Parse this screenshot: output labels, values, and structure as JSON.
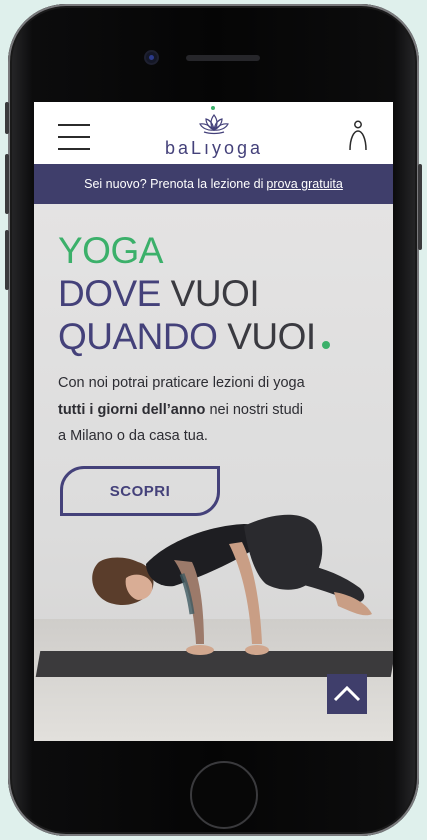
{
  "header": {
    "brand": "baLıyoga",
    "menu_icon": "hamburger-menu-icon",
    "user_icon": "user-icon"
  },
  "banner": {
    "text": "Sei nuovo? Prenota la lezione di",
    "link": "prova gratuita"
  },
  "hero": {
    "line1": "YOGA",
    "line2_a": "DOVE",
    "line2_b": "VUOI",
    "line3_a": "QUANDO",
    "line3_b": "VUOI",
    "desc_1": "Con noi potrai praticare lezioni di yoga",
    "desc_bold": "tutti i giorni dell’anno",
    "desc_2": "nei nostri studi",
    "desc_3": "a Milano o da casa tua.",
    "cta": "SCOPRI"
  },
  "scroll_top_icon": "chevron-up-icon",
  "colors": {
    "brand_purple": "#44417a",
    "accent_green": "#3bb06a",
    "banner_bg": "#3f3e6b"
  }
}
